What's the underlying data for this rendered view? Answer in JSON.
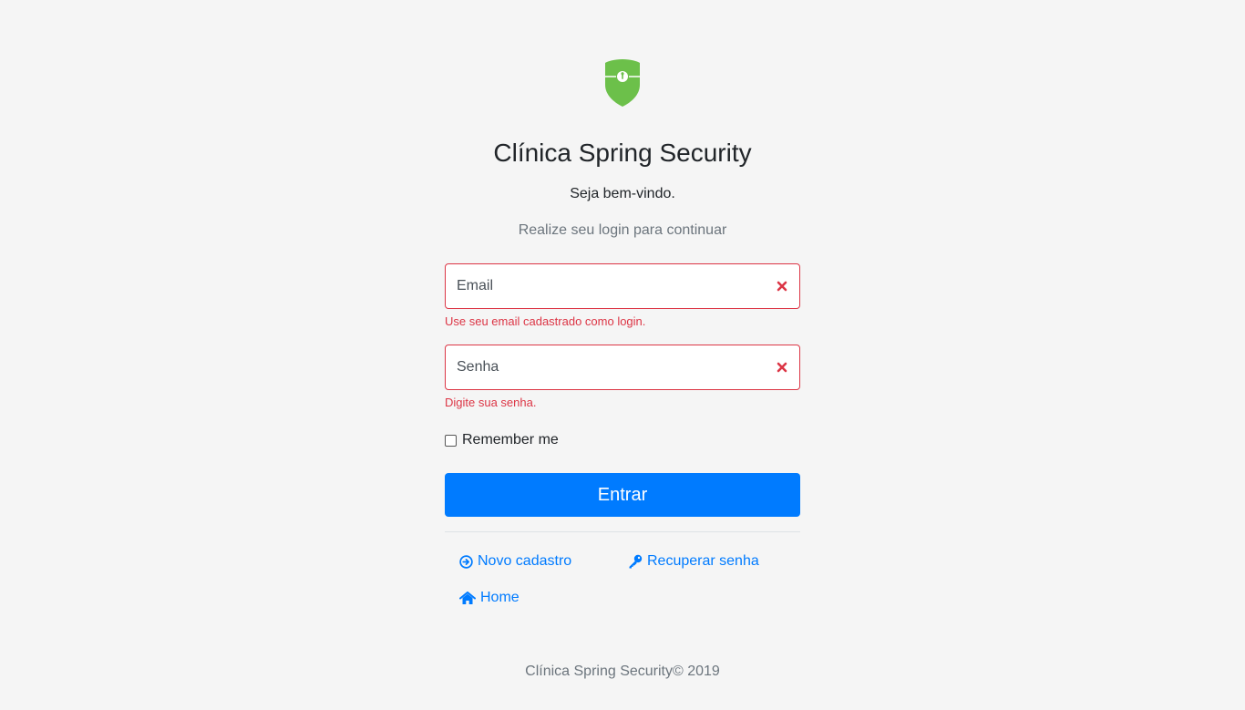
{
  "brand": {
    "logo_icon": "shield-keyhole-icon",
    "title": "Clínica Spring Security",
    "accent_color": "#6cc04a"
  },
  "welcome": "Seja bem-vindo.",
  "subtitle": "Realize seu login para continuar",
  "form": {
    "email": {
      "placeholder": "Email",
      "value": "",
      "error": "Use seu email cadastrado como login.",
      "error_icon": "times-icon"
    },
    "password": {
      "placeholder": "Senha",
      "value": "",
      "error": "Digite sua senha.",
      "error_icon": "times-icon"
    },
    "remember_label": "Remember me",
    "remember_checked": false,
    "submit_label": "Entrar",
    "error_color": "#dc3545",
    "primary_color": "#007bff"
  },
  "links": {
    "novo_cadastro": {
      "label": "Novo cadastro",
      "icon": "arrow-circle-right-icon"
    },
    "recuperar_senha": {
      "label": "Recuperar senha",
      "icon": "key-icon"
    },
    "home": {
      "label": "Home",
      "icon": "home-icon"
    }
  },
  "footer": "Clínica Spring Security© 2019"
}
